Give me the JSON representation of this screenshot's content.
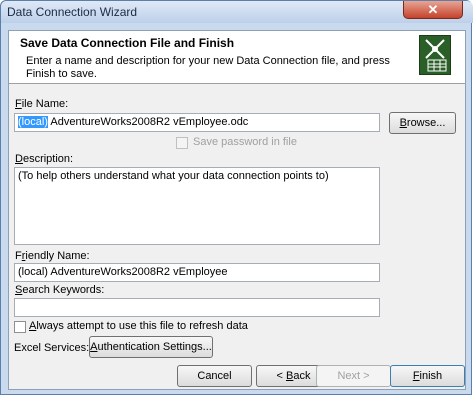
{
  "window": {
    "title": "Data Connection Wizard",
    "close_glyph": "✕"
  },
  "header": {
    "title": "Save Data Connection File and Finish",
    "description": "Enter a name and description for your new Data Connection file, and press Finish to save."
  },
  "file_name": {
    "label_u": "F",
    "label_rest": "ile Name:",
    "value_selected": "(local)",
    "value_rest": " AdventureWorks2008R2 vEmployee.odc",
    "browse_u": "B",
    "browse_rest": "rowse..."
  },
  "save_password": {
    "label": "Save password in file",
    "checked": false,
    "enabled": false
  },
  "description": {
    "label_u": "D",
    "label_rest": "escription:",
    "value": "(To help others understand what your data connection points to)"
  },
  "friendly_name": {
    "label_pre": "F",
    "label_u": "r",
    "label_rest": "iendly Name:",
    "value": "(local) AdventureWorks2008R2 vEmployee"
  },
  "search_keywords": {
    "label_u": "S",
    "label_rest": "earch Keywords:",
    "value": ""
  },
  "always_attempt": {
    "label_u": "A",
    "label_rest": "lways attempt to use this file to refresh data",
    "checked": false
  },
  "excel_services": {
    "label": "Excel Services:",
    "auth_u": "A",
    "auth_rest": "uthentication Settings..."
  },
  "buttons": {
    "cancel": "Cancel",
    "back_pre": "< ",
    "back_u": "B",
    "back_rest": "ack",
    "next": "Next >",
    "finish_u": "F",
    "finish_rest": "inish"
  },
  "colors": {
    "selection": "#3399ff",
    "icon_bg": "#2b5f28",
    "close": "#c4432b"
  }
}
